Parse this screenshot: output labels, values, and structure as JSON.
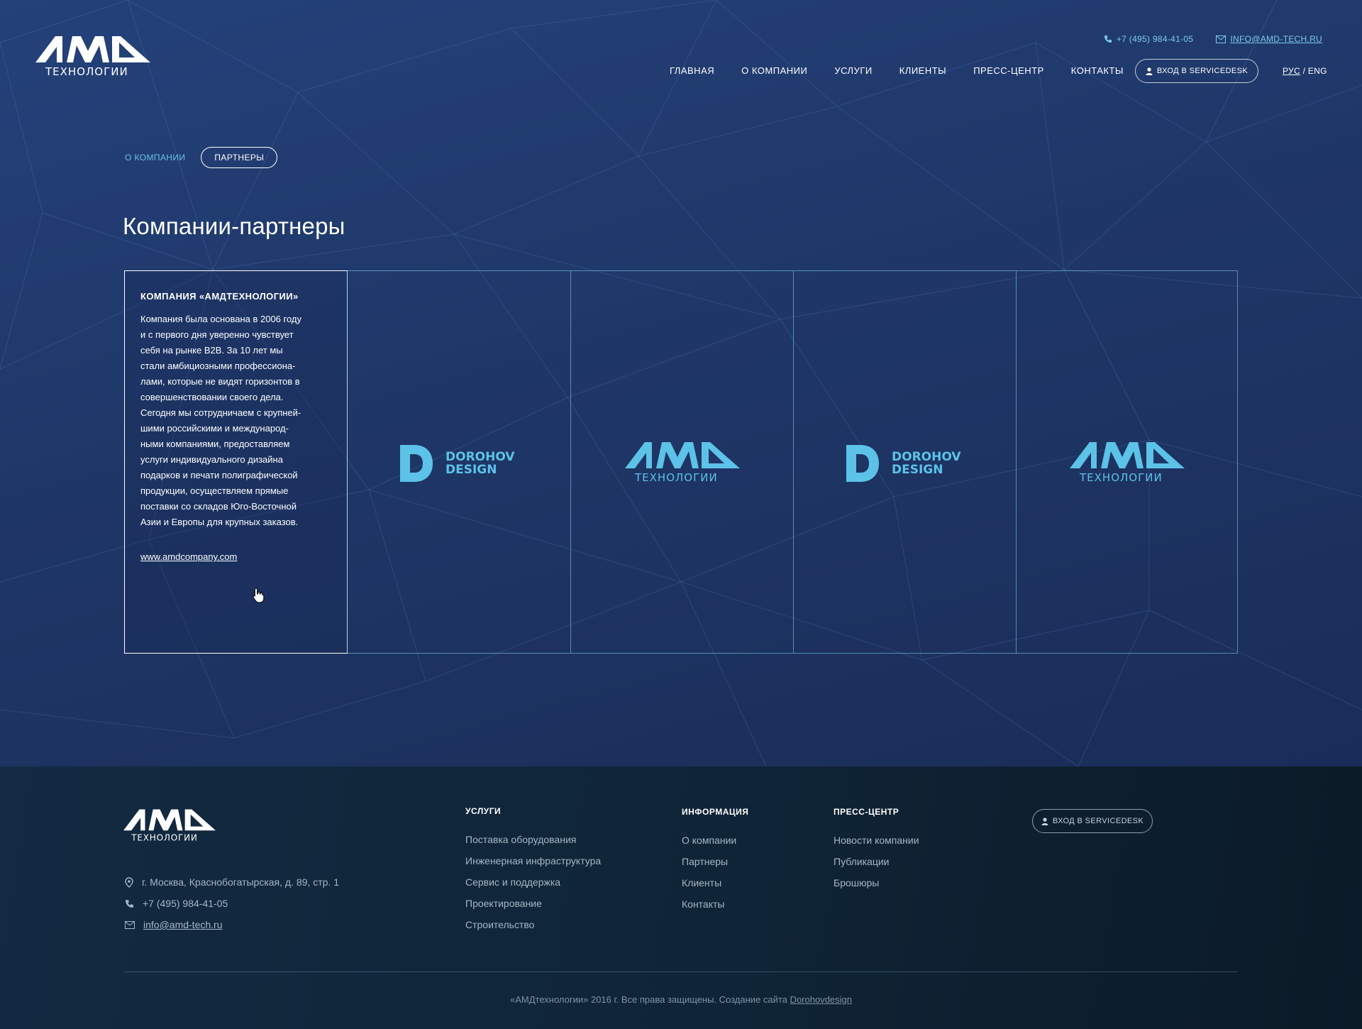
{
  "header": {
    "logo_main": "AMD",
    "logo_sub": "ТЕХНОЛОГИИ",
    "phone": "+7 (495) 984-41-05",
    "email": "INFO@AMD-TECH.RU",
    "nav": [
      "ГЛАВНАЯ",
      "О КОМПАНИИ",
      "УСЛУГИ",
      "КЛИЕНТЫ",
      "ПРЕСС-ЦЕНТР",
      "КОНТАКТЫ"
    ],
    "servicedesk_label": "ВХОД В SERVICEDESK",
    "lang_ru": "РУС",
    "lang_sep": "/",
    "lang_en": "ENG"
  },
  "subnav": {
    "link": "О КОМПАНИИ",
    "active": "ПАРТНЕРЫ"
  },
  "page_title": "Компании-партнеры",
  "featured": {
    "title": "КОМПАНИЯ «АМДТЕХНОЛОГИИ»",
    "lines": [
      "Компания была основана в 2006 году",
      "и с первого дня уверенно чувствует",
      "себя на рынке B2B. За 10 лет мы",
      "стали амбициозными профессиона-",
      "лами, которые не видят горизонтов в",
      "совершенствовании своего дела.",
      "Сегодня мы сотрудничаем с крупней-",
      "шими российскими и международ-",
      "ными компаниями, предоставляем",
      "услуги индивидуального дизайна",
      "подарков и печати полиграфической",
      "продукции, осуществляем прямые",
      "поставки со складов Юго-Восточной",
      "Азии и Европы для крупных заказов."
    ],
    "link": "www.amdcompany.com"
  },
  "partners": [
    {
      "type": "dorohov",
      "letter": "D",
      "line1": "DOROHOV",
      "line2": "DESIGN"
    },
    {
      "type": "amd",
      "line1": "AMD",
      "line2": "ТЕХНОЛОГИИ"
    },
    {
      "type": "dorohov",
      "letter": "D",
      "line1": "DOROHOV",
      "line2": "DESIGN"
    },
    {
      "type": "amd",
      "line1": "AMD",
      "line2": "ТЕХНОЛОГИИ"
    }
  ],
  "footer": {
    "address": "г. Москва, Краснобогатырская, д. 89, стр. 1",
    "phone": "+7 (495) 984-41-05",
    "email": "info@amd-tech.ru",
    "services_title": "УСЛУГИ",
    "services": [
      "Поставка оборудования",
      "Инженерная инфраструктура",
      "Сервис и поддержка",
      "Проектирование",
      "Строительство"
    ],
    "info_title": "ИНФОРМАЦИЯ",
    "info": [
      "О компании",
      "Партнеры",
      "Клиенты",
      "Контакты"
    ],
    "press_title": "ПРЕСС-ЦЕНТР",
    "press": [
      "Новости компании",
      "Публикации",
      "Брошюры"
    ],
    "servicedesk_label": "ВХОД В SERVICEDESK",
    "copyright_text": "«АМДтехнологии» 2016 г. Все права защищены. Создание сайта",
    "copyright_link": "Dorohovdesign"
  },
  "colors": {
    "accent": "#6cc2e6",
    "background": "#1e3564",
    "footer": "#102536"
  }
}
